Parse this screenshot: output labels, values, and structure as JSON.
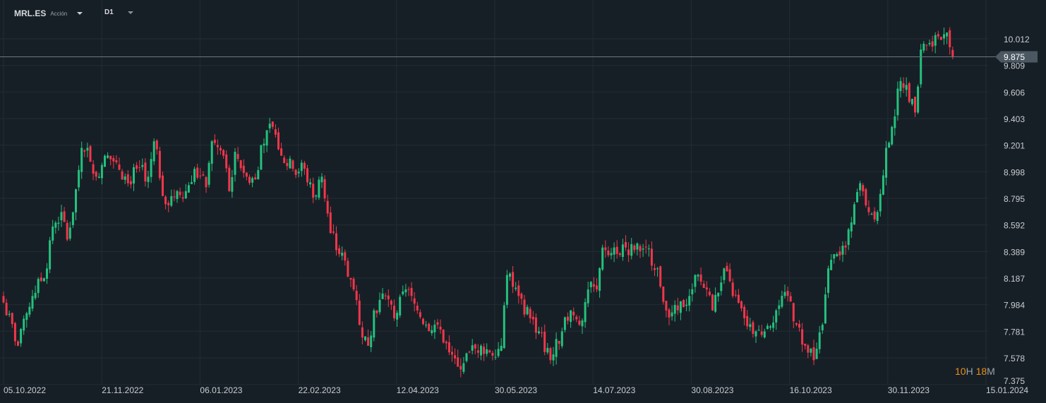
{
  "header": {
    "symbol": "MRL.ES",
    "instrument_type": "Acción",
    "timeframe": "D1"
  },
  "countdown": {
    "hours": "10",
    "hours_unit": "H",
    "minutes": "18",
    "minutes_unit": "M"
  },
  "colors": {
    "background": "#171f26",
    "grid": "#222c34",
    "up": "#23c17e",
    "down": "#f2364a",
    "price_tag": "#4b5862",
    "price_line": "#6b7780"
  },
  "chart_data": {
    "type": "candlestick",
    "title": "MRL.ES D1",
    "current_price": 9.875,
    "current_price_label": "9.875",
    "y_ticks": [
      "10.012",
      "9.809",
      "9.606",
      "9.403",
      "9.201",
      "8.998",
      "8.795",
      "8.592",
      "8.389",
      "8.187",
      "7.984",
      "7.781",
      "7.578",
      "7.375"
    ],
    "x_ticks": [
      "05.10.2022",
      "21.11.2022",
      "06.01.2023",
      "22.02.2023",
      "12.04.2023",
      "30.05.2023",
      "14.07.2023",
      "30.08.2023",
      "16.10.2023",
      "30.11.2023",
      "15.01.2024"
    ],
    "ylim": [
      7.375,
      10.2
    ],
    "grid": true,
    "approx_closes_by_trading_day": [
      [
        0,
        8.0
      ],
      [
        5,
        7.67
      ],
      [
        10,
        8.05
      ],
      [
        15,
        8.26
      ],
      [
        17,
        8.58
      ],
      [
        20,
        8.69
      ],
      [
        22,
        8.48
      ],
      [
        24,
        8.69
      ],
      [
        27,
        9.18
      ],
      [
        29,
        9.18
      ],
      [
        32,
        8.96
      ],
      [
        35,
        9.12
      ],
      [
        39,
        9.07
      ],
      [
        43,
        8.91
      ],
      [
        46,
        9.02
      ],
      [
        50,
        8.96
      ],
      [
        52,
        9.23
      ],
      [
        56,
        8.75
      ],
      [
        60,
        8.85
      ],
      [
        63,
        8.85
      ],
      [
        66,
        9.02
      ],
      [
        70,
        8.88
      ],
      [
        72,
        9.23
      ],
      [
        76,
        9.12
      ],
      [
        78,
        8.85
      ],
      [
        80,
        9.15
      ],
      [
        84,
        8.96
      ],
      [
        87,
        8.94
      ],
      [
        89,
        9.2
      ],
      [
        93,
        9.34
      ],
      [
        96,
        9.12
      ],
      [
        100,
        9.02
      ],
      [
        104,
        9.02
      ],
      [
        107,
        8.8
      ],
      [
        110,
        8.96
      ],
      [
        113,
        8.53
      ],
      [
        116,
        8.37
      ],
      [
        118,
        8.32
      ],
      [
        121,
        8.1
      ],
      [
        123,
        7.83
      ],
      [
        126,
        7.67
      ],
      [
        128,
        7.94
      ],
      [
        132,
        8.05
      ],
      [
        135,
        7.88
      ],
      [
        139,
        8.1
      ],
      [
        143,
        7.94
      ],
      [
        146,
        7.83
      ],
      [
        150,
        7.83
      ],
      [
        154,
        7.62
      ],
      [
        157,
        7.51
      ],
      [
        161,
        7.62
      ],
      [
        165,
        7.67
      ],
      [
        168,
        7.62
      ],
      [
        172,
        7.67
      ],
      [
        174,
        8.21
      ],
      [
        178,
        8.05
      ],
      [
        182,
        7.88
      ],
      [
        185,
        7.78
      ],
      [
        189,
        7.56
      ],
      [
        193,
        7.78
      ],
      [
        196,
        7.94
      ],
      [
        199,
        7.83
      ],
      [
        202,
        8.1
      ],
      [
        205,
        8.1
      ],
      [
        207,
        8.42
      ],
      [
        211,
        8.42
      ],
      [
        215,
        8.42
      ],
      [
        218,
        8.4
      ],
      [
        222,
        8.42
      ],
      [
        226,
        8.26
      ],
      [
        229,
        7.94
      ],
      [
        233,
        7.94
      ],
      [
        237,
        8.05
      ],
      [
        239,
        8.21
      ],
      [
        243,
        8.1
      ],
      [
        245,
        7.94
      ],
      [
        249,
        8.26
      ],
      [
        252,
        8.05
      ],
      [
        256,
        7.88
      ],
      [
        260,
        7.78
      ],
      [
        263,
        7.78
      ],
      [
        267,
        7.94
      ],
      [
        271,
        8.05
      ],
      [
        274,
        7.83
      ],
      [
        277,
        7.67
      ],
      [
        280,
        7.56
      ],
      [
        283,
        7.83
      ],
      [
        285,
        8.26
      ],
      [
        288,
        8.37
      ],
      [
        291,
        8.42
      ],
      [
        294,
        8.75
      ],
      [
        296,
        8.91
      ],
      [
        299,
        8.69
      ],
      [
        302,
        8.69
      ],
      [
        305,
        9.18
      ],
      [
        307,
        9.34
      ],
      [
        310,
        9.69
      ],
      [
        312,
        9.66
      ],
      [
        315,
        9.45
      ],
      [
        317,
        9.93
      ],
      [
        320,
        9.98
      ],
      [
        322,
        10.04
      ],
      [
        326,
        10.06
      ],
      [
        328,
        9.875
      ]
    ]
  }
}
